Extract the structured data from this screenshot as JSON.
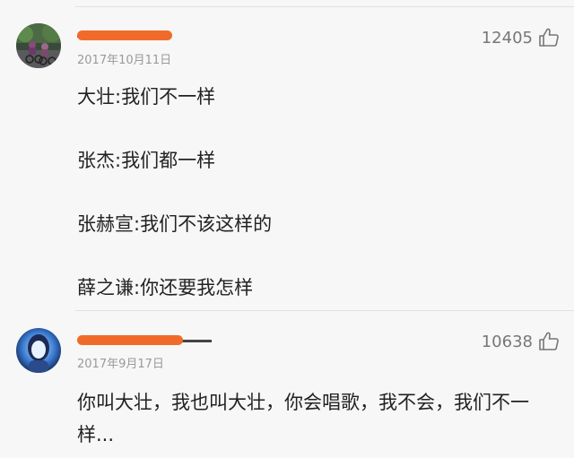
{
  "comments": [
    {
      "username_redacted": true,
      "date": "2017年10月11日",
      "likes": "12405",
      "avatar_icon": "cyclists-photo-avatar",
      "lines": [
        "大壮:我们不一样",
        "张杰:我们都一样",
        "张赫宣:我们不该这样的",
        "薛之谦:你还要我怎样"
      ]
    },
    {
      "username_redacted": true,
      "date": "2017年9月17日",
      "likes": "10638",
      "avatar_icon": "girl-portrait-avatar",
      "lines": [
        "你叫大壮，我也叫大壮，你会唱歌，我不会，我们不一",
        "样..."
      ]
    }
  ],
  "colors": {
    "background": "#f7f7f7",
    "redaction": "#f06b2a",
    "meta_text": "#9a9a9a"
  }
}
